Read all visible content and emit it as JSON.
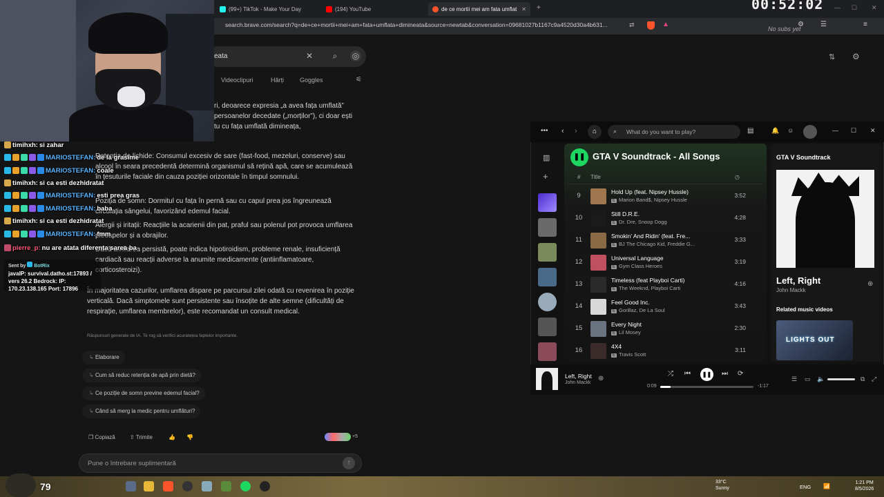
{
  "browser": {
    "tabs": [
      {
        "label": "(99+) TikTok - Make Your Day",
        "color": "#25f4ee"
      },
      {
        "label": "(194) YouTube",
        "color": "#ff0000"
      },
      {
        "label": "de ce mortii mei am fata umflat",
        "color": "#fb542b"
      }
    ],
    "new_tab_symbol": "+",
    "url": "search.brave.com/search?q=de+ce+mortii+mei+am+fata+umflata+dimineata&source=newtab&conversation=09681027b1167c9a4520d30a4b631...",
    "timer": "00:52:02",
    "no_subs": "No subs yet"
  },
  "search": {
    "query_visible": "eata",
    "nav": [
      "Videoclipuri",
      "Hărți",
      "Goggles"
    ],
    "answer": {
      "intro": "ri, deoarece expresia „a avea fața umflată” persoanelor decedate („morților”), ci doar ești tu cu fața umflată dimineața,",
      "p1": "Retenția de lichide: Consumul excesiv de sare (fast-food, mezeluri, conserve) sau alcool în seara precedentă determină organismul să rețină apă, care se acumulează în țesuturile faciale din cauza poziției orizontale în timpul somnului.",
      "p2": "Poziția de somn: Dormitul cu fața în pernă sau cu capul prea jos îngreunează circulația sângelui, favorizând edemul facial.",
      "p3": "Alergii și iritații: Reacțiile la acarienii din pat, praful sau polenul pot provoca umflarea pleoapelor și a obrajilor.",
      "p4": "Dacă umflarea persistă, poate indica hipotiroidism, probleme renale, insuficiență cardiacă sau reacții adverse la anumite medicamente (antiinflamatoare, corticosteroizi).",
      "p5": "În majoritatea cazurilor, umflarea dispare pe parcursul zilei odată cu revenirea în poziție verticală. Dacă simptomele sunt persistente sau însoțite de alte semne (dificultăți de respirație, umflarea membrelor), este recomandat un consult medical."
    },
    "disclaimer": "Răspunsuri generate de IA. Te rog să verifici acuratețea faptelor importante.",
    "followups": [
      "Elaborare",
      "Cum să reduc retenția de apă prin dietă?",
      "Ce poziție de somn previne edemul facial?",
      "Când să merg la medic pentru umflături?"
    ],
    "actions": {
      "copy": "Copiază",
      "send": "Trimite",
      "sources_count": "+5"
    },
    "ask_placeholder": "Pune o întrebare suplimentară"
  },
  "chat": [
    {
      "user": "timihxh:",
      "msg": "si zahar",
      "color": "#ffffff"
    },
    {
      "user": "MARIOSTEFAN:",
      "msg": "de la grasime",
      "color": "#5ab4ff"
    },
    {
      "user": "MARIOSTEFAN:",
      "msg": "coale",
      "color": "#5ab4ff"
    },
    {
      "user": "timihxh:",
      "msg": "si ca esti dezhidratat",
      "color": "#ffffff"
    },
    {
      "user": "MARIOSTEFAN:",
      "msg": "esti prea gras",
      "color": "#5ab4ff"
    },
    {
      "user": "MARIOSTEFAN:",
      "msg": "baba",
      "color": "#5ab4ff"
    },
    {
      "user": "timihxh:",
      "msg": "si ca esti dezhidratat",
      "color": "#ffffff"
    },
    {
      "user": "MARIOSTEFAN:",
      "msg": "fmm",
      "color": "#5ab4ff"
    },
    {
      "user": "pierre_p:",
      "msg": "nu are atata diferenta sarea ba",
      "color": "#ff5b7a"
    }
  ],
  "bot": {
    "sent_by": "Sent by",
    "bot_name": "BotRix",
    "line1": "javaIP: survival.datho.st:17893 / vers 26.2 Bedrock: IP:",
    "line2": "170.23.138.165 Port: 17896"
  },
  "spotify": {
    "search_placeholder": "What do you want to play?",
    "playlist_title": "GTA V Soundtrack - All Songs",
    "col_num": "#",
    "col_title": "Title",
    "tracks": [
      {
        "num": "9",
        "name": "Hold Up (feat. Nipsey Hussle)",
        "artist": "Marion Band$, Nipsey Hussle",
        "dur": "3:52",
        "art": "#a0764e"
      },
      {
        "num": "10",
        "name": "Still D.R.E.",
        "artist": "Dr. Dre, Snoop Dogg",
        "dur": "4:28",
        "art": "#1a1a1a"
      },
      {
        "num": "11",
        "name": "Smokin' And Ridin' (feat. Fre...",
        "artist": "BJ The Chicago Kid, Freddie G...",
        "dur": "3:33",
        "art": "#8a6a45"
      },
      {
        "num": "12",
        "name": "Universal Language",
        "artist": "Gym Class Heroes",
        "dur": "3:19",
        "art": "#c05060"
      },
      {
        "num": "13",
        "name": "Timeless (feat Playboi Carti)",
        "artist": "The Weeknd, Playboi Carti",
        "dur": "4:16",
        "art": "#2a2a2a"
      },
      {
        "num": "14",
        "name": "Feel Good Inc.",
        "artist": "Gorillaz, De La Soul",
        "dur": "3:43",
        "art": "#d8d8d8"
      },
      {
        "num": "15",
        "name": "Every Night",
        "artist": "Lil Mosey",
        "dur": "2:30",
        "art": "#6a7480"
      },
      {
        "num": "16",
        "name": "4X4",
        "artist": "Travis Scott",
        "dur": "3:11",
        "art": "#3a2a2a"
      }
    ],
    "right_panel": {
      "playlist": "GTA V Soundtrack",
      "song": "Left, Right",
      "artist": "John Mackk",
      "related": "Related music videos",
      "video_text": "LIGHTS OUT"
    },
    "player": {
      "title": "Left, Right",
      "artist": "John Mackk",
      "elapsed": "0:09",
      "remaining": "-1:17",
      "progress": 0.11
    }
  },
  "taskbar": {
    "score": "79",
    "weather_temp": "33°C",
    "weather_desc": "Sunny",
    "lang": "ENG",
    "time": "1:21 PM",
    "date": "8/5/2026"
  }
}
